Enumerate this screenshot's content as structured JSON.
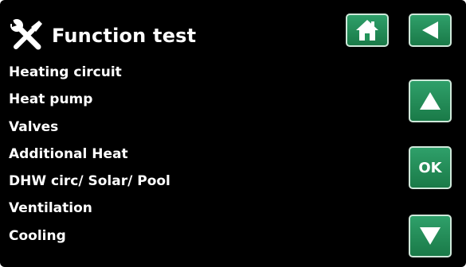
{
  "header": {
    "title": "Function test",
    "icon": "tools-icon"
  },
  "menu": {
    "items": [
      {
        "label": "Heating circuit"
      },
      {
        "label": "Heat pump"
      },
      {
        "label": "Valves"
      },
      {
        "label": "Additional Heat"
      },
      {
        "label": "DHW circ/ Solar/ Pool"
      },
      {
        "label": "Ventilation"
      },
      {
        "label": "Cooling"
      }
    ]
  },
  "buttons": {
    "home": "home-icon",
    "back": "back-arrow-icon",
    "up": "up-arrow-icon",
    "ok_label": "OK",
    "down": "down-arrow-icon"
  },
  "colors": {
    "background": "#000000",
    "button": "#23945a",
    "text": "#ffffff"
  }
}
